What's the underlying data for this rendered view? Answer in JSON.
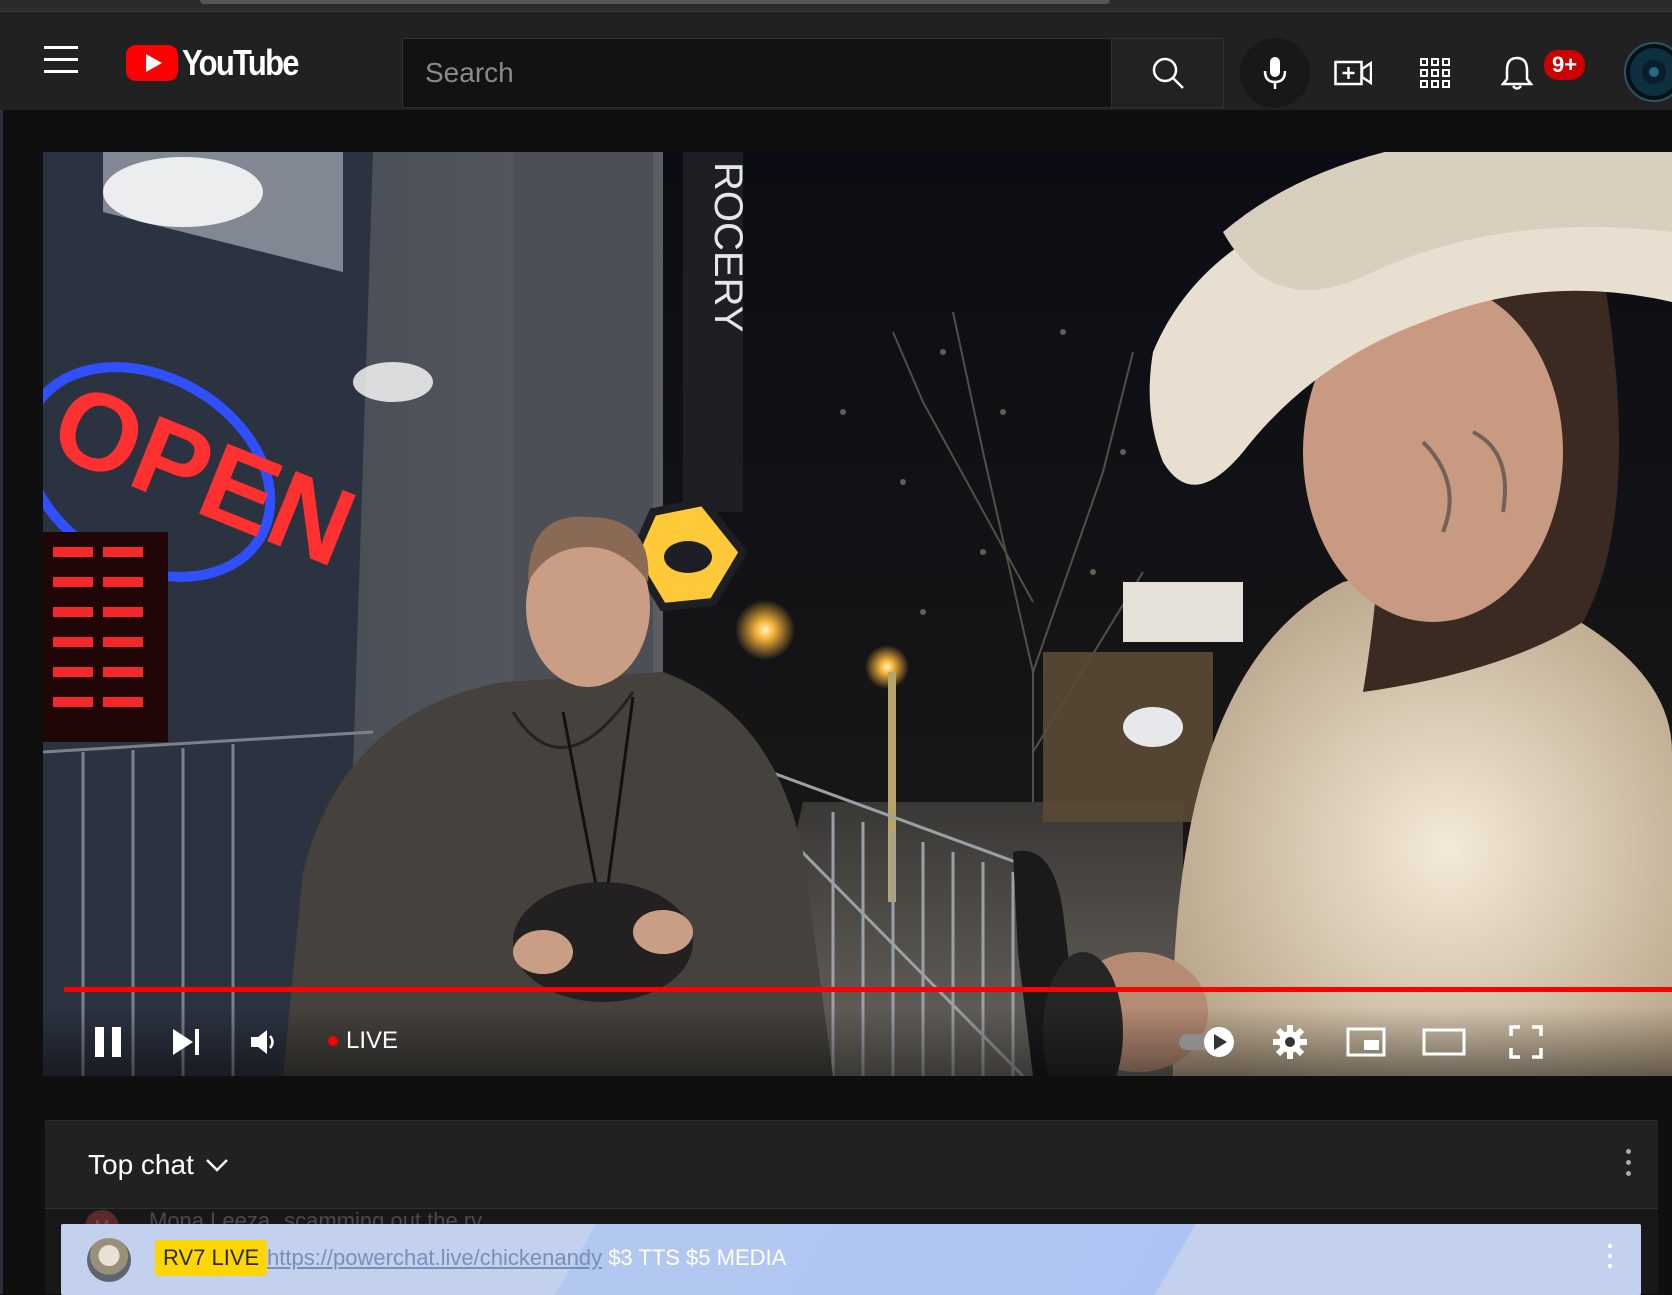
{
  "app": {
    "logo_text": "YouTube"
  },
  "masthead": {
    "search_placeholder": "Search",
    "notification_count": "9+"
  },
  "player": {
    "live_label": "LIVE",
    "progress_fraction": 1.0,
    "accent_color": "#ff0000",
    "scene_sign_open": "OPEN",
    "scene_sign_grocery": "ROCERY"
  },
  "chat": {
    "title": "Top chat",
    "ghost_message": {
      "avatar_letter": "M",
      "author": "Mona Leeza",
      "text": "scamming out the rv"
    },
    "pinned": {
      "badge": "RV7 LIVE",
      "link_text": "https://powerchat.live/chickenandy",
      "suffix_text": " $3 TTS $5 MEDIA"
    }
  }
}
